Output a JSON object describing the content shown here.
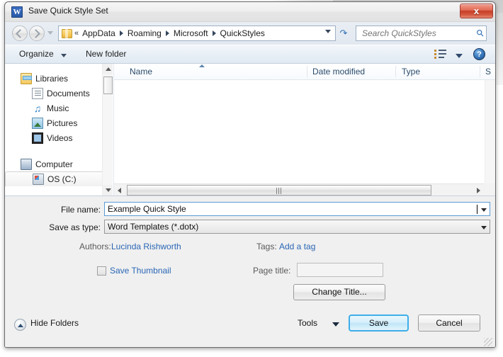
{
  "window": {
    "title": "Save Quick Style Set",
    "app_icon": "word-icon",
    "close_label": "x"
  },
  "addressbar": {
    "back_icon": "back-arrow-icon",
    "forward_icon": "forward-arrow-icon",
    "recent_icon": "chevron-down-icon",
    "folder_icon": "folder-icon",
    "overflow": "«",
    "crumbs": [
      "AppData",
      "Roaming",
      "Microsoft",
      "QuickStyles"
    ],
    "dropdown_icon": "chevron-down-icon",
    "refresh_icon": "refresh-icon",
    "search_placeholder": "Search QuickStyles",
    "search_value": "",
    "search_icon": "search-icon"
  },
  "toolbar": {
    "organize_label": "Organize",
    "organize_arrow_icon": "chevron-down-icon",
    "new_folder_label": "New folder",
    "view_icon": "view-list-icon",
    "view_arrow_icon": "chevron-down-icon",
    "help_icon": "help-icon",
    "help_label": "?"
  },
  "navpane": {
    "items": [
      {
        "label": "Libraries",
        "icon": "libraries-icon",
        "level": 0,
        "selected": false
      },
      {
        "label": "Documents",
        "icon": "documents-icon",
        "level": 1,
        "selected": false
      },
      {
        "label": "Music",
        "icon": "music-icon",
        "level": 1,
        "selected": false
      },
      {
        "label": "Pictures",
        "icon": "pictures-icon",
        "level": 1,
        "selected": false
      },
      {
        "label": "Videos",
        "icon": "videos-icon",
        "level": 1,
        "selected": false
      },
      {
        "label": "Computer",
        "icon": "computer-icon",
        "level": 0,
        "selected": false
      },
      {
        "label": "OS (C:)",
        "icon": "drive-icon",
        "level": 1,
        "selected": true
      }
    ],
    "scroll_up_icon": "scroll-up-arrow-icon",
    "scroll_down_icon": "scroll-down-arrow-icon"
  },
  "filelist": {
    "columns": [
      "Name",
      "Date modified",
      "Type",
      "S"
    ],
    "sort_column": "Name",
    "sort_direction": "ascending",
    "rows": [],
    "hscroll_left_icon": "scroll-left-arrow-icon",
    "hscroll_right_icon": "scroll-right-arrow-icon"
  },
  "form": {
    "filename_label": "File name:",
    "filename_value": "Example Quick Style",
    "filename_dropdown_icon": "chevron-down-icon",
    "savetype_label": "Save as type:",
    "savetype_value": "Word Templates (*.dotx)",
    "savetype_dropdown_icon": "chevron-down-icon",
    "authors_label": "Authors:",
    "authors_value": "Lucinda Rishworth",
    "tags_label": "Tags:",
    "tags_value": "Add a tag",
    "save_thumbnail_label": "Save Thumbnail",
    "save_thumbnail_checked": false,
    "page_title_label": "Page title:",
    "page_title_value": "",
    "change_title_label": "Change Title..."
  },
  "footer": {
    "hide_folders_label": "Hide Folders",
    "hide_folders_icon": "chevron-up-circle-icon",
    "tools_label": "Tools",
    "tools_arrow_icon": "chevron-down-icon",
    "save_label": "Save",
    "cancel_label": "Cancel"
  },
  "colors": {
    "accent": "#2a66b5",
    "default_button_border": "#3daee9",
    "close_button": "#c63d26",
    "dialog_bg": "#f0f0f0"
  }
}
